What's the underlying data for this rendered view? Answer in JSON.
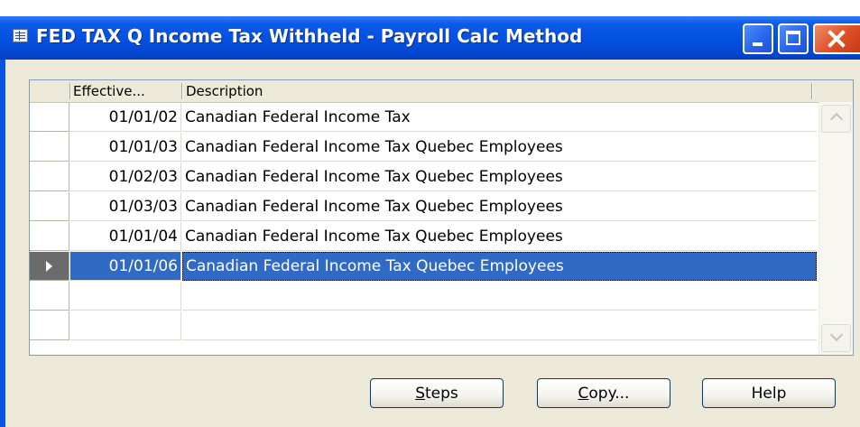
{
  "window": {
    "title": "FED TAX Q Income Tax Withheld - Payroll Calc Method"
  },
  "grid": {
    "columns": [
      "Effective...",
      "Description"
    ],
    "rows": [
      {
        "date": "01/01/02",
        "description": "Canadian Federal Income Tax"
      },
      {
        "date": "01/01/03",
        "description": "Canadian Federal Income Tax Quebec Employees"
      },
      {
        "date": "01/02/03",
        "description": "Canadian Federal Income Tax Quebec Employees"
      },
      {
        "date": "01/03/03",
        "description": "Canadian Federal Income Tax Quebec Employees"
      },
      {
        "date": "01/01/04",
        "description": "Canadian Federal Income Tax Quebec Employees"
      },
      {
        "date": "01/01/06",
        "description": "Canadian Federal Income Tax Quebec Employees"
      }
    ],
    "selected_row": 6
  },
  "buttons": {
    "steps": {
      "mnemonic": "S",
      "rest": "teps"
    },
    "copy": {
      "mnemonic": "C",
      "rest": "opy..."
    },
    "help": "Help"
  },
  "colors": {
    "titlebar": "#0550e0",
    "selection": "#316ac5",
    "dialog_face": "#ece9d8",
    "close_button": "#de4f25"
  },
  "icons": [
    "app-icon",
    "minimize-icon",
    "maximize-icon",
    "close-icon",
    "row-pointer-icon",
    "scroll-up-icon",
    "scroll-down-icon"
  ]
}
